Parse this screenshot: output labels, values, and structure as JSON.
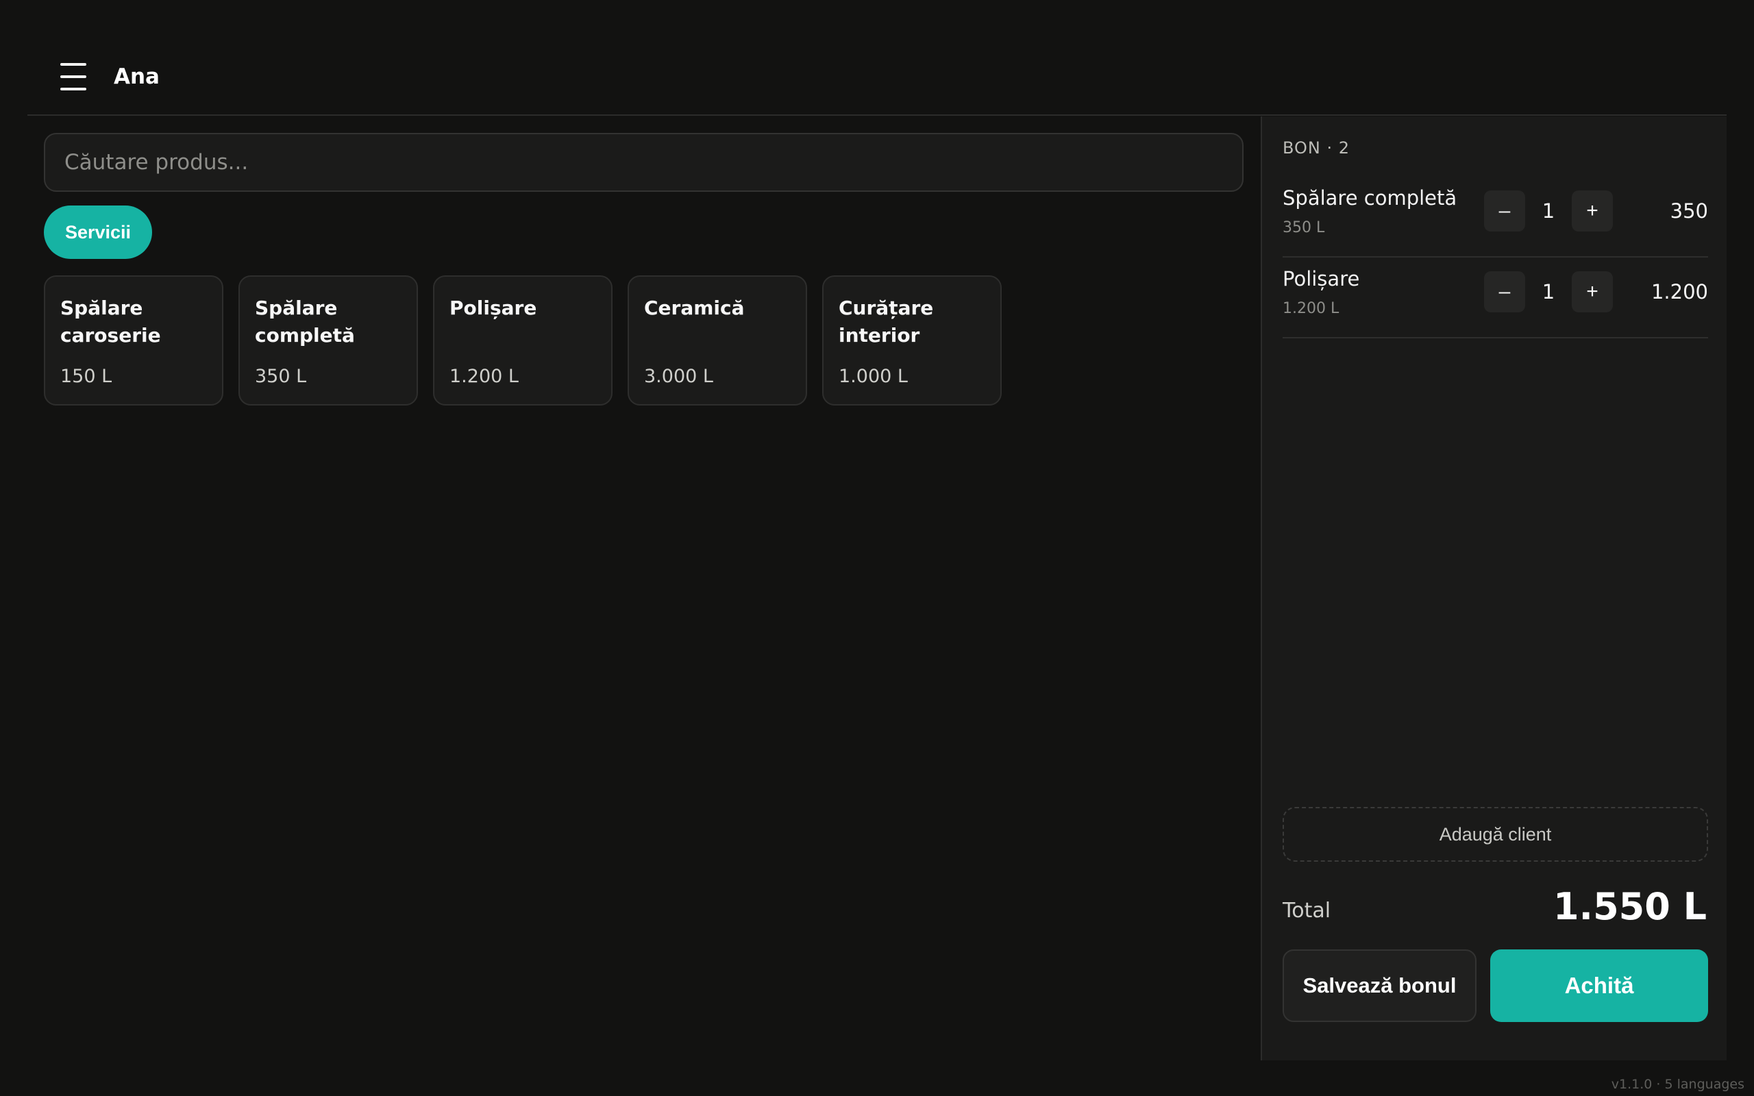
{
  "header": {
    "menu_icon": "hamburger-menu-icon",
    "user_name": "Ana"
  },
  "search": {
    "placeholder": "Căutare produs...",
    "value": ""
  },
  "categories": [
    {
      "label": "Servicii",
      "active": true
    }
  ],
  "products": [
    {
      "name": "Spălare caroserie",
      "price": "150 L"
    },
    {
      "name": "Spălare completă",
      "price": "350 L"
    },
    {
      "name": "Polișare",
      "price": "1.200 L"
    },
    {
      "name": "Ceramică",
      "price": "3.000 L"
    },
    {
      "name": "Curățare interior",
      "price": "1.000 L"
    }
  ],
  "receipt": {
    "title": "BON · 2",
    "lines": [
      {
        "name": "Spălare completă",
        "unit_price": "350 L",
        "qty": "1",
        "total": "350",
        "minus": "–",
        "plus": "+"
      },
      {
        "name": "Polișare",
        "unit_price": "1.200 L",
        "qty": "1",
        "total": "1.200",
        "minus": "–",
        "plus": "+"
      }
    ],
    "add_client_label": "Adaugă client",
    "total_label": "Total",
    "total_value": "1.550 L",
    "save_label": "Salvează bonul",
    "pay_label": "Achită"
  },
  "footer": {
    "version": "v1.1.0 · 5 languages"
  },
  "colors": {
    "accent": "#16b3a3",
    "background": "#121211",
    "panel": "#1a1a19"
  }
}
